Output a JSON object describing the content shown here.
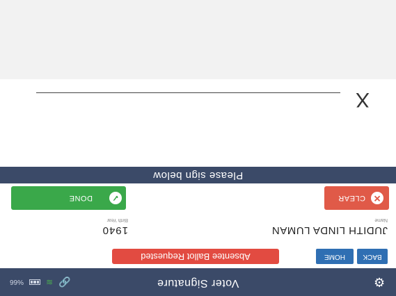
{
  "header": {
    "title": "Voter Signature",
    "settings_icon": "gear-icon",
    "status": {
      "signal_text": "%66",
      "battery_icon": "battery-icon",
      "wifi_icon": "wifi-icon",
      "link_icon": "link-icon"
    }
  },
  "toolbar": {
    "back_label": "BACK",
    "home_label": "HOME",
    "absentee_label": "Absentee Ballot Requested"
  },
  "voter": {
    "name": "JUDITH LINDA LUMAN",
    "name_label": "Name",
    "birth_year": "1940",
    "birth_year_label": "Birth Year"
  },
  "actions": {
    "clear_label": "CLEAR",
    "clear_icon": "close-icon",
    "done_label": "DONE",
    "done_icon": "check-icon"
  },
  "signature": {
    "prompt": "Please sign below",
    "x_mark": "X"
  },
  "colors": {
    "header_bg": "#3b4a68",
    "blue_button": "#2f6fb3",
    "red": "#e24b41",
    "green": "#3aa84a"
  }
}
